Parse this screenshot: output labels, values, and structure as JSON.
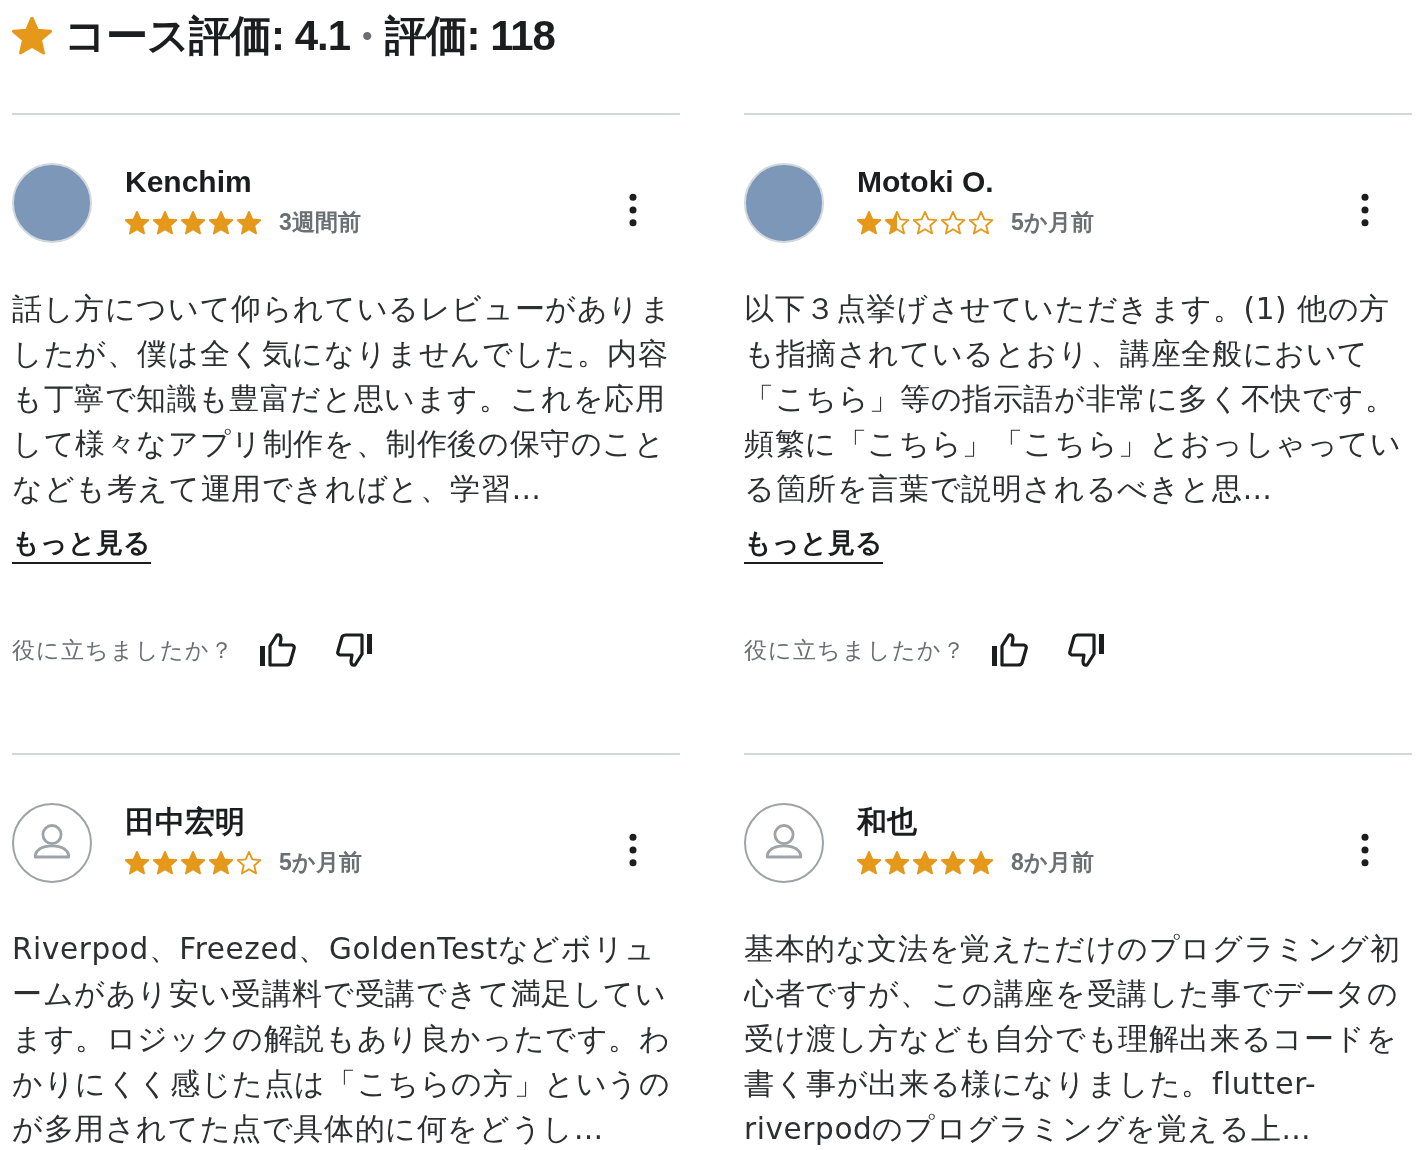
{
  "header": {
    "rating_label": "コース評価: 4.1",
    "separator": "•",
    "count_label": "評価: 118"
  },
  "reviews": [
    {
      "photo": true,
      "name": "Kenchim",
      "stars": 5,
      "date": "3週間前",
      "text": "話し方について仰られているレビューがありましたが、僕は全く気になりませんでした。内容も丁寧で知識も豊富だと思います。これを応用して様々なアプリ制作を、制作後の保守のことなども考えて運用できればと、学習…",
      "more": "もっと見る",
      "helpful": "役に立ちましたか？"
    },
    {
      "photo": true,
      "name": "Motoki O.",
      "stars": 1.5,
      "date": "5か月前",
      "text": "以下３点挙げさせていただきます。(1) 他の方も指摘されているとおり、講座全般において「こちら」等の指示語が非常に多く不快です。頻繁に「こちら」「こちら」とおっしゃっている箇所を言葉で説明されるべきと思…",
      "more": "もっと見る",
      "helpful": "役に立ちましたか？"
    },
    {
      "photo": false,
      "name": "田中宏明",
      "stars": 4,
      "date": "5か月前",
      "text": "Riverpod、Freezed、GoldenTestなどボリュームがあり安い受講料で受講できて満足しています。ロジックの解説もあり良かったです。わかりにくく感じた点は「こちらの方」というのが多用されてた点で具体的に何をどうし…"
    },
    {
      "photo": false,
      "name": "和也",
      "stars": 5,
      "date": "8か月前",
      "text": "基本的な文法を覚えただけのプログラミング初心者ですが、この講座を受講した事でデータの受け渡し方なども自分でも理解出来るコードを書く事が出来る様になりました。flutter-riverpodのプログラミングを覚える上…"
    }
  ]
}
